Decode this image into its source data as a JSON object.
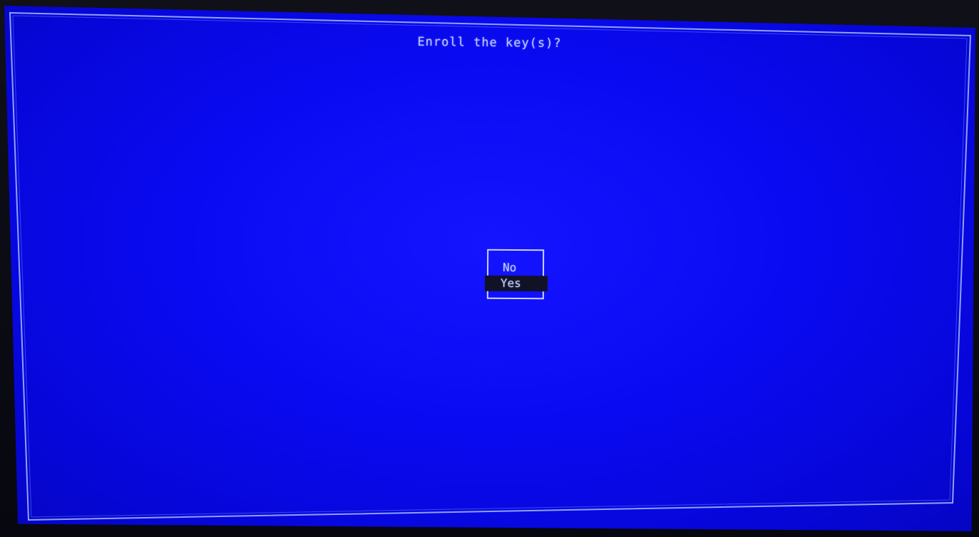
{
  "dialog": {
    "title": "Enroll the key(s)?"
  },
  "menu": {
    "options": [
      {
        "label": "No",
        "selected": false
      },
      {
        "label": "Yes",
        "selected": true
      }
    ]
  },
  "colors": {
    "background": "#0a0af2",
    "border": "#b9c7ff",
    "text": "#c5d0ff",
    "highlight": "#121226"
  }
}
